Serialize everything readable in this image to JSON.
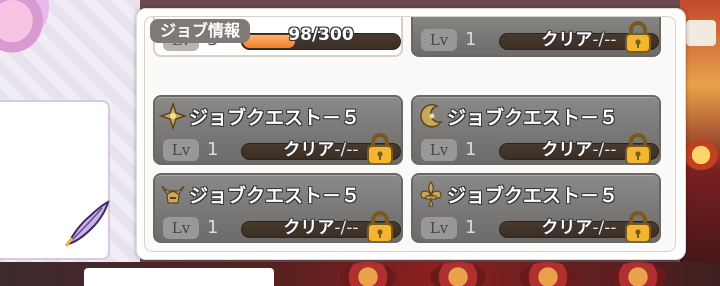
{
  "panel": {
    "section_label": "ジョブ情報"
  },
  "cards": [
    {
      "position": "top-left",
      "state": "active",
      "level_label": "Lv",
      "level": "3",
      "progress_text": "98/300",
      "progress": 0.327
    },
    {
      "position": "top-right",
      "state": "locked",
      "level_label": "Lv",
      "level": "1",
      "clear_text": "クリア",
      "clear_suffix": "-/--"
    },
    {
      "position": "mid-left",
      "state": "locked",
      "emblem": "cross-emblem-icon",
      "title": "ジョブクエスト－５",
      "level_label": "Lv",
      "level": "1",
      "clear_text": "クリア",
      "clear_suffix": "-/--"
    },
    {
      "position": "mid-right",
      "state": "locked",
      "emblem": "crescent-emblem-icon",
      "title": "ジョブクエスト－５",
      "level_label": "Lv",
      "level": "1",
      "clear_text": "クリア",
      "clear_suffix": "-/--"
    },
    {
      "position": "bottom-left",
      "state": "locked",
      "emblem": "horned-helmet-emblem-icon",
      "title": "ジョブクエスト－５",
      "level_label": "Lv",
      "level": "1",
      "clear_text": "クリア",
      "clear_suffix": "-/--"
    },
    {
      "position": "bottom-right",
      "state": "locked",
      "emblem": "fleur-de-lis-emblem-icon",
      "title": "ジョブクエスト－５",
      "level_label": "Lv",
      "level": "1",
      "clear_text": "クリア",
      "clear_suffix": "-/--"
    }
  ],
  "colors": {
    "locked_card": "#7f7d7b",
    "progress_fill": "#f0802a",
    "lock_gold": "#f2b632"
  }
}
